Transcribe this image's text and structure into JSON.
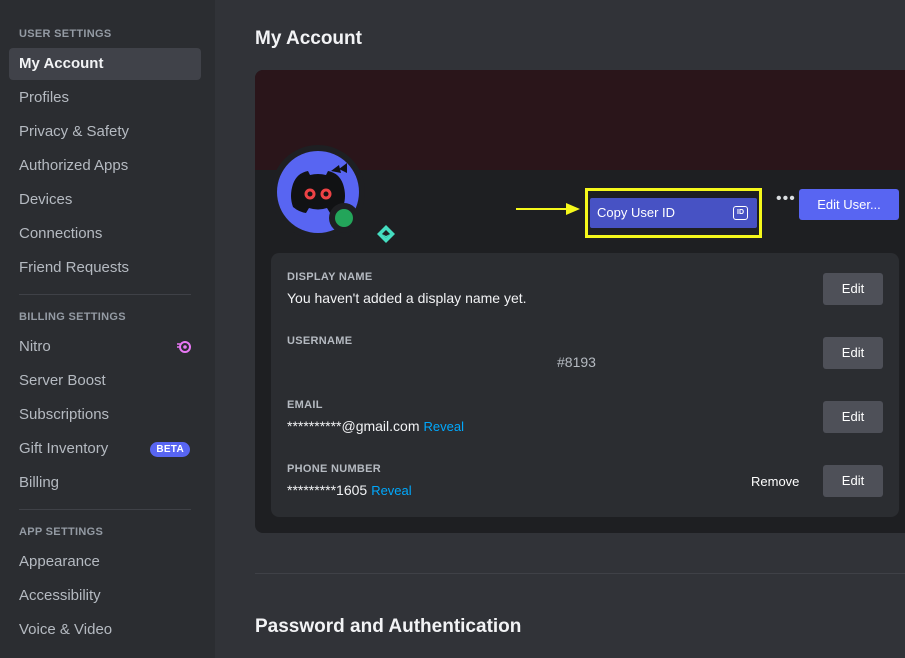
{
  "sidebar": {
    "user_settings_header": "USER SETTINGS",
    "user_items": [
      "My Account",
      "Profiles",
      "Privacy & Safety",
      "Authorized Apps",
      "Devices",
      "Connections",
      "Friend Requests"
    ],
    "billing_header": "BILLING SETTINGS",
    "billing_items": [
      "Nitro",
      "Server Boost",
      "Subscriptions",
      "Gift Inventory",
      "Billing"
    ],
    "beta_badge": "BETA",
    "app_header": "APP SETTINGS",
    "app_items": [
      "Appearance",
      "Accessibility",
      "Voice & Video"
    ],
    "active_item": "My Account"
  },
  "main": {
    "title": "My Account",
    "copy_user_id": "Copy User ID",
    "id_chip": "ID",
    "more": "•••",
    "edit_user": "Edit User...",
    "fields": {
      "display_name_label": "DISPLAY NAME",
      "display_name_value": "You haven't added a display name yet.",
      "username_label": "USERNAME",
      "username_value": "#8193",
      "email_label": "EMAIL",
      "email_value": "**********@gmail.com",
      "phone_label": "PHONE NUMBER",
      "phone_value": "*********1605",
      "reveal": "Reveal",
      "edit": "Edit",
      "remove": "Remove"
    },
    "section_title": "Password and Authentication"
  },
  "colors": {
    "accent": "#5865f2",
    "highlight_border": "#f5f81b",
    "online": "#23a55a",
    "link": "#00a8fc",
    "banner": "#2a151a"
  }
}
